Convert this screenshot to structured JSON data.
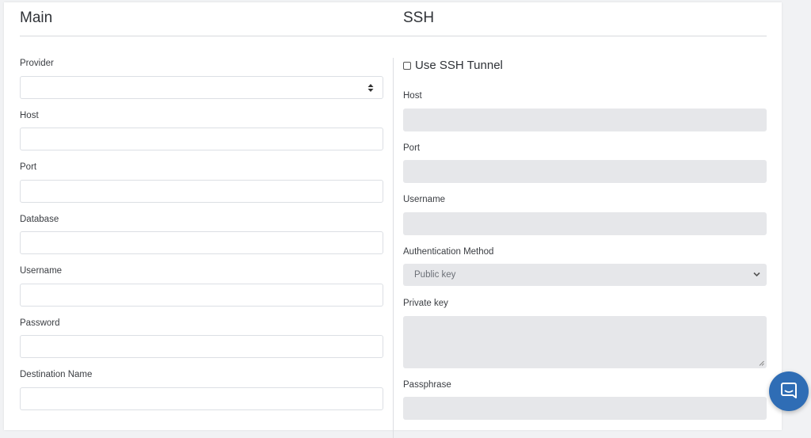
{
  "main": {
    "title": "Main",
    "provider": {
      "label": "Provider",
      "value": ""
    },
    "host": {
      "label": "Host",
      "value": ""
    },
    "port": {
      "label": "Port",
      "value": ""
    },
    "database": {
      "label": "Database",
      "value": ""
    },
    "username": {
      "label": "Username",
      "value": ""
    },
    "password": {
      "label": "Password",
      "value": ""
    },
    "destination_name": {
      "label": "Destination Name",
      "value": ""
    }
  },
  "ssh": {
    "title": "SSH",
    "use_tunnel_label": "Use SSH Tunnel",
    "use_tunnel_checked": false,
    "host": {
      "label": "Host",
      "value": ""
    },
    "port": {
      "label": "Port",
      "value": ""
    },
    "username": {
      "label": "Username",
      "value": ""
    },
    "auth_method": {
      "label": "Authentication Method",
      "value": "Public key"
    },
    "private_key": {
      "label": "Private key",
      "value": ""
    },
    "passphrase": {
      "label": "Passphrase",
      "value": ""
    }
  },
  "icons": {
    "provider_select": "sort-arrows-icon",
    "auth_select": "chevron-down-icon",
    "chat": "chat-bubble-icon"
  },
  "colors": {
    "accent": "#2f6db5",
    "disabled_field": "#e6e7ea",
    "page_background": "#f1f2f4"
  }
}
